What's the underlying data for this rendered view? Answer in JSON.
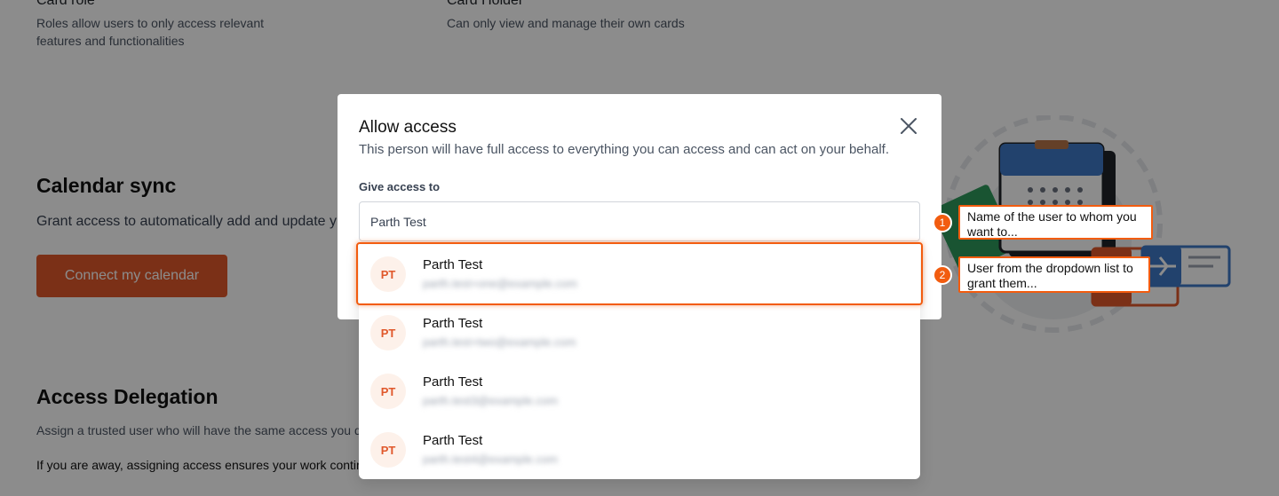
{
  "roles": {
    "card_role": {
      "title": "Card role",
      "desc_line1": "Roles allow users to only access relevant",
      "desc_line2": "features and functionalities"
    },
    "card_holder": {
      "title": "Card Holder",
      "desc": "Can only view and manage their own cards"
    }
  },
  "calendar_sync": {
    "title": "Calendar sync",
    "text": "Grant access to automatically add and update y",
    "button": "Connect my calendar"
  },
  "access_delegation": {
    "title": "Access Delegation",
    "text1": "Assign a trusted user who will have the same access you d",
    "text2": "If you are away, assigning access ensures your work contir"
  },
  "modal": {
    "title": "Allow access",
    "subtitle": "This person will have full access to everything you can access and can act on your behalf.",
    "field_label": "Give access to",
    "field_value": "Parth Test"
  },
  "dropdown": {
    "options": [
      {
        "initials": "PT",
        "name": "Parth Test",
        "email": "parth.test+one@example.com"
      },
      {
        "initials": "PT",
        "name": "Parth Test",
        "email": "parth.test+two@example.com"
      },
      {
        "initials": "PT",
        "name": "Parth Test",
        "email": "parth.test3@example.com"
      },
      {
        "initials": "PT",
        "name": "Parth Test",
        "email": "parth.test4@example.com"
      }
    ]
  },
  "callouts": [
    {
      "number": "1",
      "line1": "Name of the user to whom you",
      "line2": "want to..."
    },
    {
      "number": "2",
      "line1": "User from the dropdown list to",
      "line2": "grant them..."
    }
  ],
  "colors": {
    "accent": "#f25c0f",
    "button": "#e0582b",
    "overlay": "rgba(0,0,0,0.45)"
  },
  "icons": {
    "close": "close-icon",
    "illustration": "calendar-travel-illustration"
  }
}
